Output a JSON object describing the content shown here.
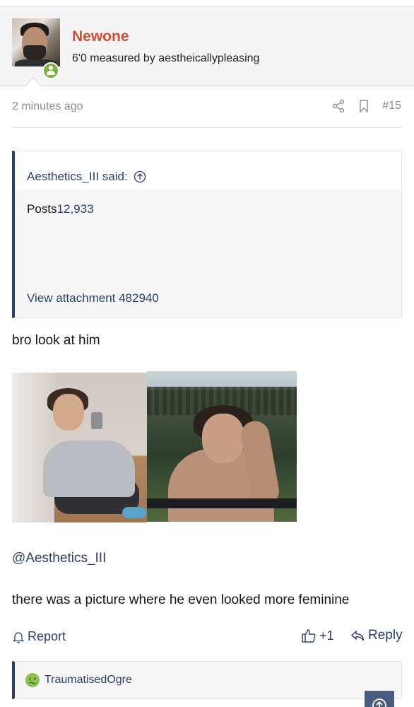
{
  "post_header": {
    "username": "Newone",
    "user_title": "6'0 measured by aestheicallypleasing",
    "online": true
  },
  "meta": {
    "time": "2 minutes ago",
    "post_number": "#15"
  },
  "quote": {
    "author_said": "Aesthetics_III said:",
    "posts_label": "Posts",
    "posts_count": "12,933",
    "attachment_link": "View attachment 482940"
  },
  "post": {
    "text_1": "bro look at him",
    "mention": "@Aesthetics_III",
    "text_2": "there was a picture where he even looked more feminine"
  },
  "actions": {
    "report": "Report",
    "reaction_count": "+1",
    "reply": "Reply"
  },
  "reactions": {
    "reactor_name": "TraumatisedOgre"
  },
  "colors": {
    "username": "#d64c33",
    "link": "#2c3f6b",
    "online_badge": "#7bb23d"
  }
}
